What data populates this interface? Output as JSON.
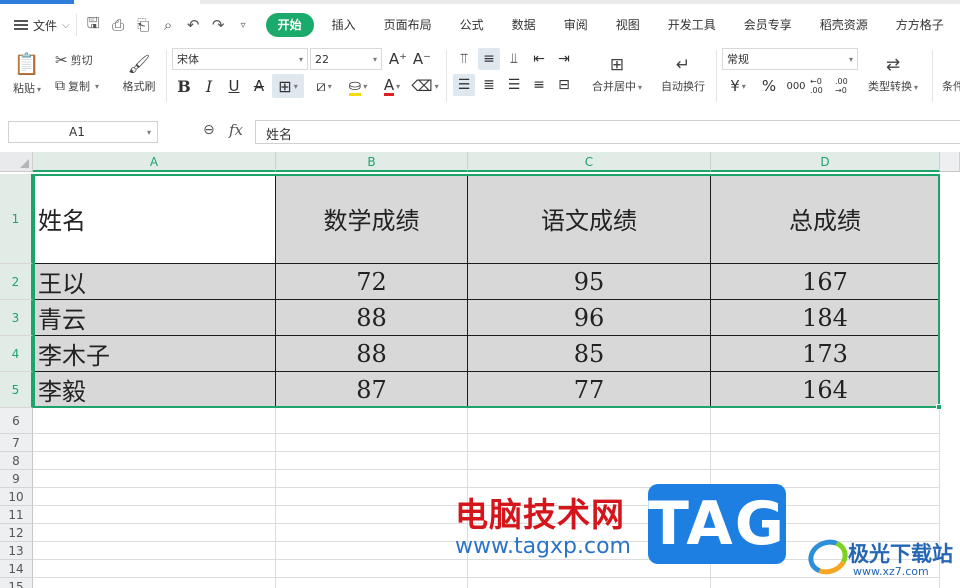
{
  "menu": {
    "file_label": "文件",
    "tabs": [
      "开始",
      "插入",
      "页面布局",
      "公式",
      "数据",
      "审阅",
      "视图",
      "开发工具",
      "会员专享",
      "稻壳资源",
      "方方格子"
    ]
  },
  "ribbon": {
    "paste": "粘贴",
    "cut": "剪切",
    "copy": "复制",
    "format_painter": "格式刷",
    "font_name": "宋体",
    "font_size": "22",
    "bold": "B",
    "italic": "I",
    "underline": "U",
    "strike": "A",
    "merge_center": "合并居中",
    "wrap_text": "自动换行",
    "number_format": "常规",
    "currency": "¥",
    "percent": "%",
    "thousands": "000",
    "dec_inc": "←0 .00",
    "dec_dec": ".00 →0",
    "type_convert": "类型转换",
    "conditional": "条件"
  },
  "formula_bar": {
    "cell_ref": "A1",
    "fx": "fx",
    "content": "姓名"
  },
  "sheet": {
    "columns": [
      "A",
      "B",
      "C",
      "D"
    ],
    "rows": [
      "1",
      "2",
      "3",
      "4",
      "5",
      "6",
      "7",
      "8",
      "9",
      "10",
      "11",
      "12",
      "13",
      "14",
      "15"
    ],
    "header": [
      "姓名",
      "数学成绩",
      "语文成绩",
      "总成绩"
    ],
    "data": [
      [
        "王以",
        "72",
        "95",
        "167"
      ],
      [
        "青云",
        "88",
        "96",
        "184"
      ],
      [
        "李木子",
        "88",
        "85",
        "173"
      ],
      [
        "李毅",
        "87",
        "77",
        "164"
      ]
    ]
  },
  "watermark": {
    "site_cn": "电脑技术网",
    "site_url": "www.tagxp.com",
    "tag": "TAG",
    "jg_name": "极光下载站",
    "jg_url": "www.xz7.com"
  },
  "colors": {
    "accent_green": "#1ea36b",
    "tab_active": "#1aaa6b",
    "cell_fill": "#d8d8d8"
  }
}
